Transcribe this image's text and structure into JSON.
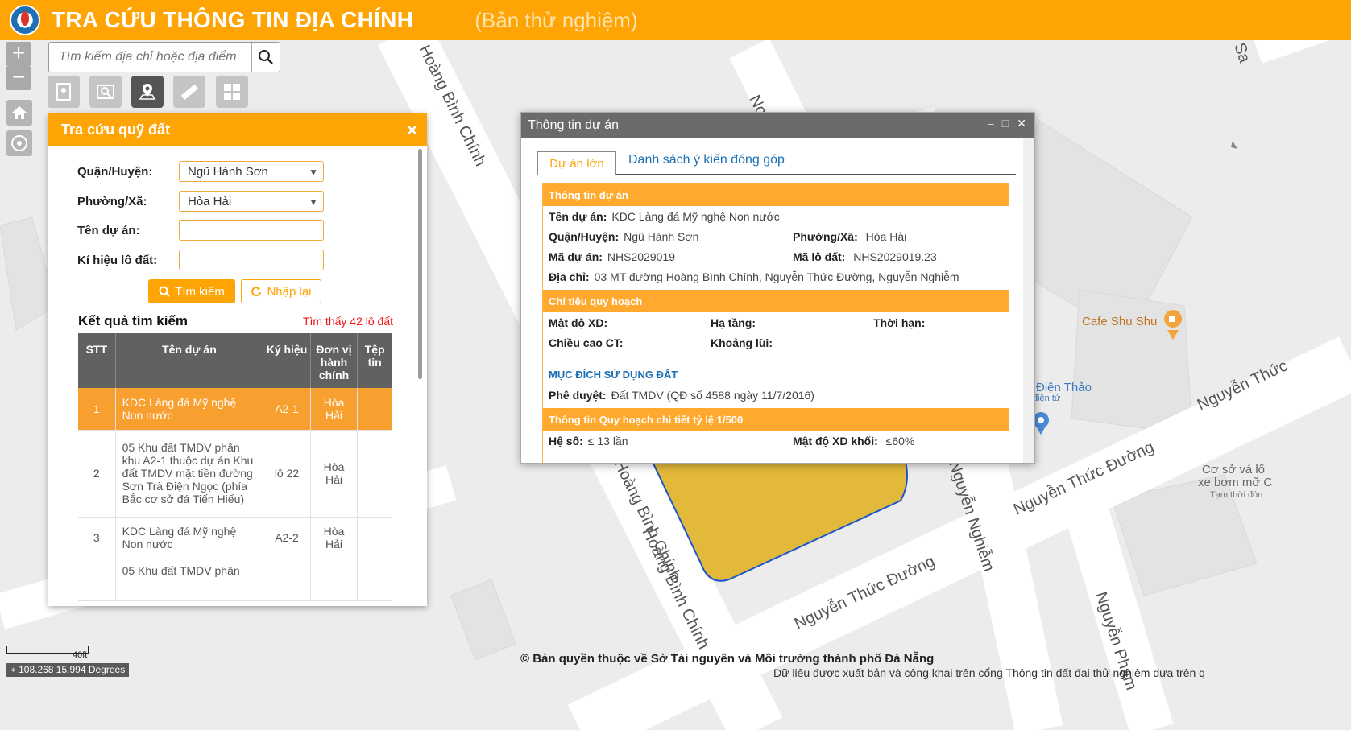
{
  "header": {
    "title": "TRA CỨU THÔNG TIN ĐỊA CHÍNH",
    "subtitle": "(Bản thử nghiệm)"
  },
  "controls": {
    "zoom_in": "+",
    "zoom_out": "−"
  },
  "search": {
    "placeholder": "Tìm kiếm địa chỉ hoặc địa điểm"
  },
  "map": {
    "roads": [
      "Hoàng Bình Chính",
      "Nguyễn Thức Đường",
      "Nguyễn Nghiễm",
      "Nguyễn Phạm",
      "Nguyễn Thức Đường",
      "Hoàng Bình Chính",
      "Nguyễn Thức",
      "No",
      "g Sa"
    ],
    "pois": [
      {
        "name": "Cafe Shu Shu"
      },
      {
        "name": "Điện Thảo",
        "sub": "điện tử"
      },
      {
        "name": "Cơ sở vá lố",
        "line2": "xe bơm mỡ C",
        "sub": "Tạm thời đón"
      }
    ],
    "parcel_color": "#e2b93b"
  },
  "panel": {
    "title": "Tra cứu quỹ đất",
    "close": "×",
    "district_label": "Quận/Huyện:",
    "district_value": "Ngũ Hành Sơn",
    "ward_label": "Phường/Xã:",
    "ward_value": "Hòa Hải",
    "project_label": "Tên dự án:",
    "plot_label": "Kí hiệu lô đất:",
    "search_btn": "Tìm kiếm",
    "reset_btn": "Nhập lại",
    "result_title": "Kết quả tìm kiếm",
    "result_count": "Tìm thấy 42 lô đất",
    "columns": [
      "STT",
      "Tên dự án",
      "Ký hiệu",
      "Đơn vị hành chính",
      "Tệp tin"
    ],
    "rows": [
      {
        "stt": "1",
        "name": "KDC Làng đá Mỹ nghệ Non nước",
        "code": "A2-1",
        "unit": "Hòa Hải",
        "file": ""
      },
      {
        "stt": "2",
        "name": "05 Khu đất TMDV phân khu A2-1 thuộc dự án Khu đất TMDV mặt tiền đường Sơn Trà Điện Ngọc (phía Bắc cơ sở đá Tiến Hiếu)",
        "code": "lô 22",
        "unit": "Hòa Hải",
        "file": ""
      },
      {
        "stt": "3",
        "name": "KDC Làng đá Mỹ nghệ Non nước",
        "code": "A2-2",
        "unit": "Hòa Hải",
        "file": ""
      },
      {
        "stt": "",
        "name": "05 Khu đất TMDV phân",
        "code": "",
        "unit": "",
        "file": ""
      }
    ]
  },
  "dialog": {
    "title": "Thông tin dự án",
    "tab1": "Dự án lớn",
    "tab2": "Danh sách ý kiến đóng góp",
    "sec1": "Thông tin dự án",
    "name_label": "Tên dự án:",
    "name_value": "KDC Làng đá Mỹ nghệ Non nước",
    "district_label": "Quận/Huyện:",
    "district_value": "Ngũ Hành Sơn",
    "ward_label": "Phường/Xã:",
    "ward_value": "Hòa Hải",
    "code_label": "Mã dự án:",
    "code_value": "NHS2029019",
    "lot_label": "Mã lô đất:",
    "lot_value": "NHS2029019.23",
    "addr_label": "Địa chỉ:",
    "addr_value": "03 MT đường Hoàng Bình Chính, Nguyễn Thức Đường, Nguyễn Nghiễm",
    "sec2": "Chỉ tiêu quy hoạch",
    "density_label": "Mật độ XD:",
    "infra_label": "Hạ tầng:",
    "term_label": "Thời hạn:",
    "height_label": "Chiều cao CT:",
    "setback_label": "Khoảng lùi:",
    "purpose_head": "MỤC ĐÍCH SỬ DỤNG ĐẤT",
    "approved_label": "Phê duyệt:",
    "approved_value": "Đất TMDV (QĐ số 4588 ngày 11/7/2016)",
    "sec3": "Thông tin Quy hoạch chi tiết tỷ lệ 1/500",
    "ratio_label": "Hệ số:",
    "ratio_value": "≤ 13 lần",
    "block_label": "Mật độ XD khối:",
    "block_value": "≤60%"
  },
  "footer": {
    "scale": "40ft",
    "coords": "108.268 15.994 Degrees",
    "copyright": "© Bản quyền thuộc về Sở Tài nguyên và Môi trường thành phố Đà Nẵng",
    "disclaimer": "Dữ liệu được xuất bản và công khai trên cổng Thông tin đất đai thử nghiệm dựa trên q"
  }
}
